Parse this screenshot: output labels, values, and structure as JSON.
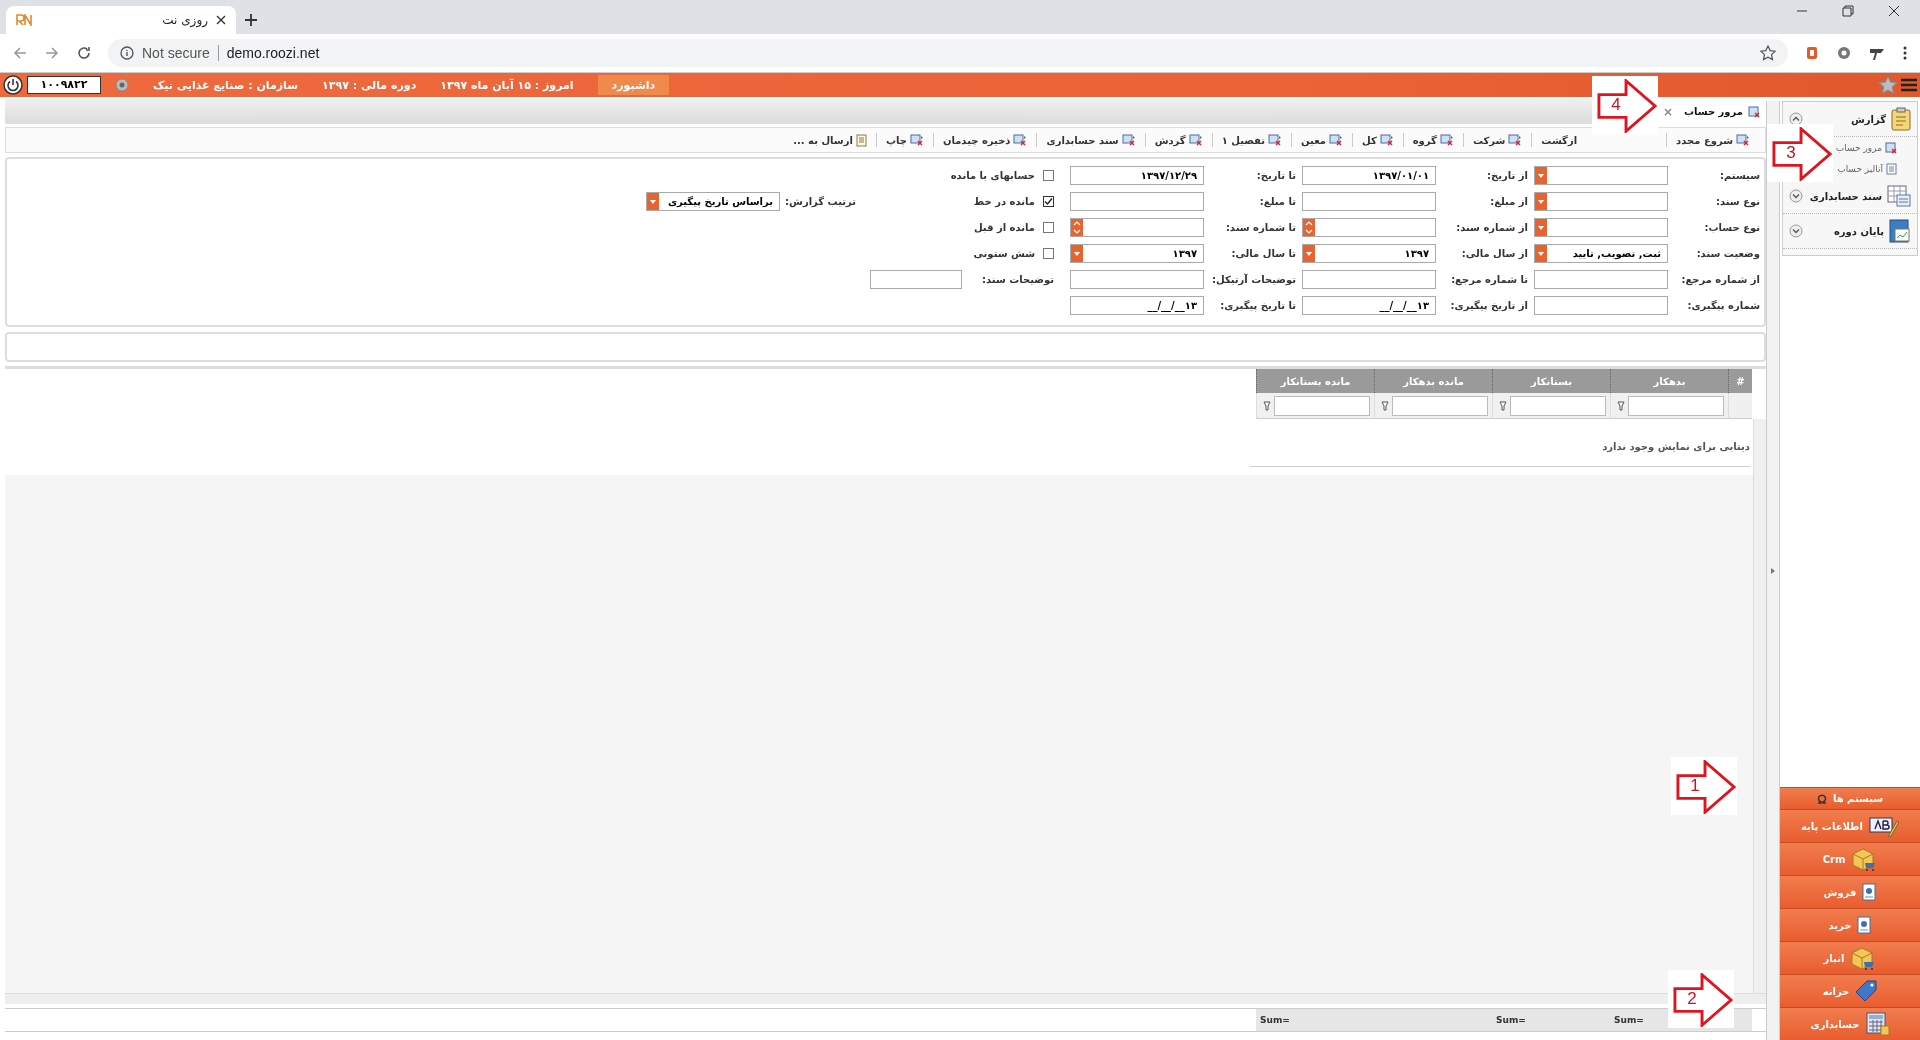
{
  "browser": {
    "tab_title": "روزی نت",
    "security": "Not secure",
    "url": "demo.roozi.net"
  },
  "header": {
    "dashboard": "داشبورد",
    "items": [
      "امروز : ۱۵ آبان ماه ۱۳۹۷",
      "دوره مالی : ۱۳۹۷",
      "سازمان : صنایع غذایی نیک"
    ],
    "user_code": "۱۰۰۹۸۲۲"
  },
  "doc_tabs": [
    {
      "label": "مرور حساب",
      "selected": true,
      "close": "×"
    }
  ],
  "toolbar": [
    {
      "label": "شروع مجدد",
      "kind": "report"
    },
    {
      "label": "ازگشت",
      "kind": "plain"
    },
    {
      "label": "شرکت",
      "kind": "report"
    },
    {
      "label": "گروه",
      "kind": "report"
    },
    {
      "label": "کل",
      "kind": "report"
    },
    {
      "label": "معین",
      "kind": "report"
    },
    {
      "label": "تفصیل ۱",
      "kind": "report"
    },
    {
      "label": "گردش",
      "kind": "report"
    },
    {
      "label": "سند حسابداری",
      "kind": "report"
    },
    {
      "label": "ذخیره چیدمان",
      "kind": "report"
    },
    {
      "label": "چاپ",
      "kind": "report"
    },
    {
      "label": "ارسال به ...",
      "kind": "doc"
    }
  ],
  "form": {
    "rows": [
      [
        {
          "kind": "select",
          "label": "سیستم:"
        },
        {
          "kind": "text",
          "label": "از تاریخ:",
          "value": "۱۳۹۷/۰۱/۰۱"
        },
        {
          "kind": "text",
          "label": "تا تاریخ:",
          "value": "۱۳۹۷/۱۲/۲۹"
        },
        {
          "kind": "checkbox",
          "label": "حسابهای با مانده",
          "checked": false
        }
      ],
      [
        {
          "kind": "select",
          "label": "نوع سند:"
        },
        {
          "kind": "text",
          "label": "از مبلغ:"
        },
        {
          "kind": "text",
          "label": "تا مبلغ:"
        },
        {
          "kind": "checkbox",
          "label": "مانده در خط",
          "checked": true
        },
        {
          "kind": "select",
          "label": "ترتیب گزارش:",
          "value": "براساس تاریخ پیگیری"
        }
      ],
      [
        {
          "kind": "select",
          "label": "نوع حساب:"
        },
        {
          "kind": "spin",
          "label": "از شماره سند:"
        },
        {
          "kind": "spin",
          "label": "تا شماره سند:"
        },
        {
          "kind": "checkbox",
          "label": "مانده از قبل",
          "checked": false
        }
      ],
      [
        {
          "kind": "select",
          "label": "وضعیت سند:",
          "value": "ثبت, تصویب, تایید"
        },
        {
          "kind": "select",
          "label": "از سال مالی:",
          "value": "۱۳۹۷"
        },
        {
          "kind": "select",
          "label": "تا سال مالی:",
          "value": "۱۳۹۷"
        },
        {
          "kind": "checkbox",
          "label": "شش ستونی",
          "checked": false
        }
      ],
      [
        {
          "kind": "text",
          "label": "از شماره مرجع:"
        },
        {
          "kind": "text",
          "label": "تا شماره مرجع:"
        },
        {
          "kind": "text",
          "label": "توضیحات آرتیکل:"
        },
        {
          "kind": "text",
          "label": "توضیحات سند:"
        }
      ],
      [
        {
          "kind": "text",
          "label": "شماره پیگیری:"
        },
        {
          "kind": "text",
          "label": "از تاریخ پیگیری:",
          "value": "۱۳__/__/__"
        },
        {
          "kind": "text",
          "label": "تا تاریخ پیگیری:",
          "value": "۱۳__/__/__"
        }
      ]
    ]
  },
  "grid": {
    "columns": [
      "#",
      "بدهکار",
      "بستانکار",
      "مانده بدهکار",
      "مانده بستانکار"
    ],
    "empty_message": "دیتایی برای نمایش وجود ندارد",
    "footer": [
      "=Sum",
      "=Sum",
      "=Sum"
    ]
  },
  "sidebar": {
    "tree": [
      {
        "label": "گزارش",
        "expanded": true,
        "children": [
          {
            "label": "مرور حساب"
          },
          {
            "label": "آنالیز حساب"
          }
        ]
      },
      {
        "label": "سند حسابداری",
        "expanded": false
      },
      {
        "label": "پایان دوره",
        "expanded": false
      }
    ],
    "menu": [
      {
        "label": "سیستم ها"
      },
      {
        "label": "اطلاعات پایه"
      },
      {
        "label": "Crm"
      },
      {
        "label": "فروش"
      },
      {
        "label": "خرید"
      },
      {
        "label": "انبار"
      },
      {
        "label": "خزانه"
      },
      {
        "label": "حسابداری"
      }
    ]
  },
  "annotations": [
    {
      "label": "4"
    },
    {
      "label": "3"
    },
    {
      "label": "1"
    },
    {
      "label": "2"
    }
  ]
}
